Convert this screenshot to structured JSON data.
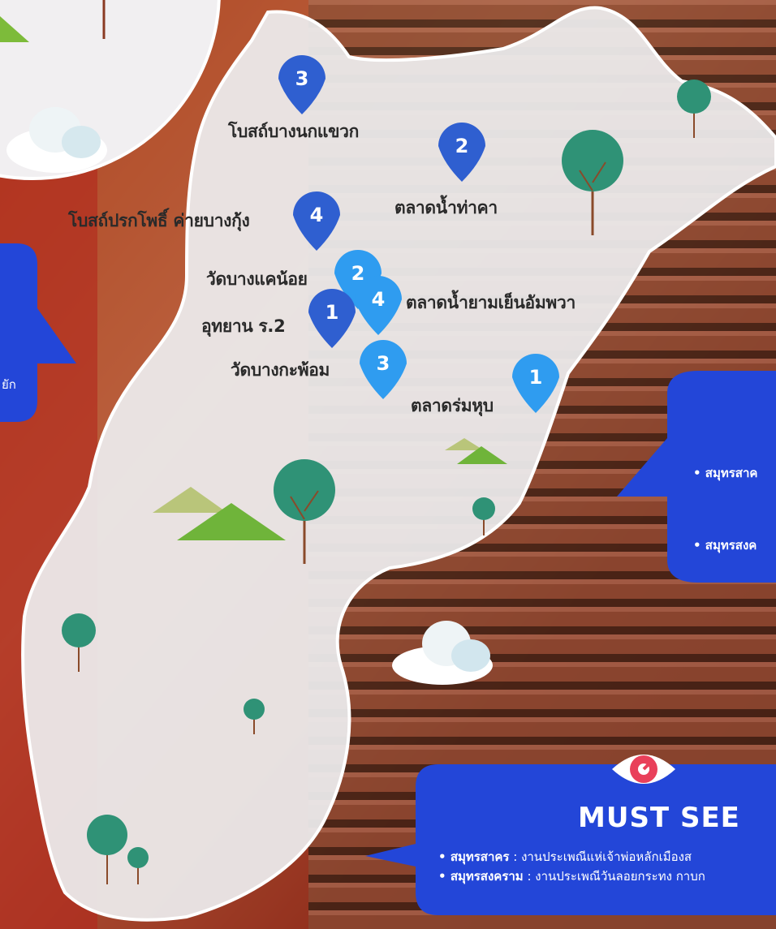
{
  "pins": [
    {
      "num": "3",
      "label": "โบสถ์บางนกแขวก",
      "color": "#2f5fd0"
    },
    {
      "num": "2",
      "label": "ตลาดน้ำท่าคา",
      "color": "#2f5fd0"
    },
    {
      "num": "4",
      "label": "โบสถ์ปรกโพธิ์ ค่ายบางกุ้ง",
      "color": "#2f5fd0"
    },
    {
      "num": "2",
      "label": "วัดบางแคน้อย",
      "color": "#2f9cf0"
    },
    {
      "num": "4",
      "label": "ตลาดน้ำยามเย็นอัมพวา",
      "color": "#2f9cf0"
    },
    {
      "num": "1",
      "label": "อุทยาน ร.2",
      "color": "#2f5fd0"
    },
    {
      "num": "3",
      "label": "วัดบางกะพ้อม",
      "color": "#2f9cf0"
    },
    {
      "num": "1",
      "label": "ตลาดร่มหุบ",
      "color": "#2f9cf0"
    }
  ],
  "left_bubble": {
    "text": "ยัก"
  },
  "right_bubble": {
    "line1": "• สมุทรสาค",
    "line2": "• สมุทรสงค"
  },
  "must_see": {
    "title": "MUST SEE",
    "rows": [
      {
        "bullet": "• ",
        "name": "สมุทรสาคร",
        "sep": "   : ",
        "desc": "งานประเพณีแห่เจ้าพ่อหลักเมืองส"
      },
      {
        "bullet": "• ",
        "name": "สมุทรสงคราม",
        "sep": " : ",
        "desc": "งานประเพณีวันลอยกระทง กาบก"
      }
    ]
  },
  "colors": {
    "bubble": "#2346d8",
    "pin_dark": "#2f5fd0",
    "pin_light": "#2f9cf0",
    "map": "#eceaec"
  }
}
